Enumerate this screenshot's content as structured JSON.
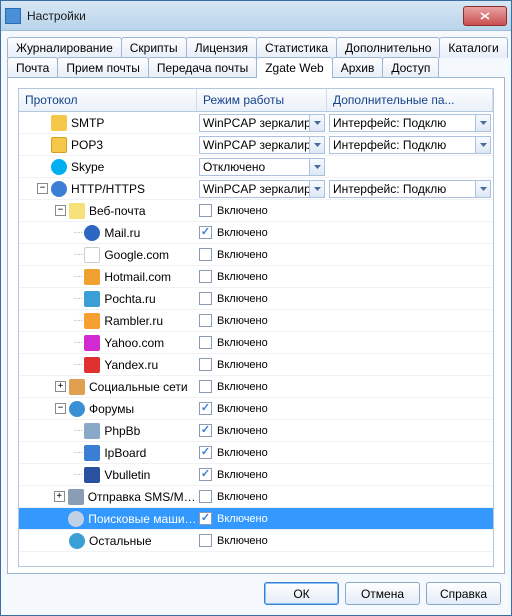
{
  "window": {
    "title": "Настройки"
  },
  "tabs_row1": [
    "Журналирование",
    "Скрипты",
    "Лицензия",
    "Статистика",
    "Дополнительно",
    "Каталоги"
  ],
  "tabs_row2": [
    "Почта",
    "Прием почты",
    "Передача почты",
    "Zgate Web",
    "Архив",
    "Доступ"
  ],
  "active_tab": "Zgate Web",
  "columns": {
    "proto": "Протокол",
    "mode": "Режим работы",
    "extra": "Дополнительные па..."
  },
  "checkbox_label": "Включено",
  "mode_off": "Отключено",
  "mode_pcap": "WinPCAP зеркалиров",
  "extra_iface": "Интерфейс: Подклю",
  "rows": [
    {
      "indent": 0,
      "expander": "none",
      "icon": "i-smtp",
      "name": "SMTP",
      "mode": "combo_pcap",
      "extra": "combo_iface"
    },
    {
      "indent": 0,
      "expander": "none",
      "icon": "i-pop3",
      "name": "POP3",
      "mode": "combo_pcap",
      "extra": "combo_iface"
    },
    {
      "indent": 0,
      "expander": "none",
      "icon": "i-skype",
      "name": "Skype",
      "mode": "combo_off",
      "extra": ""
    },
    {
      "indent": 0,
      "expander": "minus",
      "icon": "i-http",
      "name": "HTTP/HTTPS",
      "mode": "combo_pcap",
      "extra": "combo_iface"
    },
    {
      "indent": 1,
      "expander": "minus",
      "icon": "i-web",
      "name": "Веб-почта",
      "mode": "check_off",
      "extra": ""
    },
    {
      "indent": 2,
      "expander": "leaf",
      "icon": "i-mail",
      "name": "Mail.ru",
      "mode": "check_on",
      "extra": ""
    },
    {
      "indent": 2,
      "expander": "leaf",
      "icon": "i-google",
      "name": "Google.com",
      "mode": "check_off",
      "extra": ""
    },
    {
      "indent": 2,
      "expander": "leaf",
      "icon": "i-hotmail",
      "name": "Hotmail.com",
      "mode": "check_off",
      "extra": ""
    },
    {
      "indent": 2,
      "expander": "leaf",
      "icon": "i-pochta",
      "name": "Pochta.ru",
      "mode": "check_off",
      "extra": ""
    },
    {
      "indent": 2,
      "expander": "leaf",
      "icon": "i-rambler",
      "name": "Rambler.ru",
      "mode": "check_off",
      "extra": ""
    },
    {
      "indent": 2,
      "expander": "leaf",
      "icon": "i-yahoo",
      "name": "Yahoo.com",
      "mode": "check_off",
      "extra": ""
    },
    {
      "indent": 2,
      "expander": "leaf",
      "icon": "i-yandex",
      "name": "Yandex.ru",
      "mode": "check_off",
      "extra": ""
    },
    {
      "indent": 1,
      "expander": "plus",
      "icon": "i-social",
      "name": "Социальные сети",
      "mode": "check_off",
      "extra": ""
    },
    {
      "indent": 1,
      "expander": "minus",
      "icon": "i-forum",
      "name": "Форумы",
      "mode": "check_on",
      "extra": ""
    },
    {
      "indent": 2,
      "expander": "leaf",
      "icon": "i-phpbb",
      "name": "PhpBb",
      "mode": "check_on",
      "extra": ""
    },
    {
      "indent": 2,
      "expander": "leaf",
      "icon": "i-ipb",
      "name": "IpBoard",
      "mode": "check_on",
      "extra": ""
    },
    {
      "indent": 2,
      "expander": "leaf",
      "icon": "i-vb",
      "name": "Vbulletin",
      "mode": "check_on",
      "extra": ""
    },
    {
      "indent": 1,
      "expander": "plus",
      "icon": "i-sms",
      "name": "Отправка SMS/MMS",
      "mode": "check_off",
      "extra": ""
    },
    {
      "indent": 1,
      "expander": "none",
      "icon": "i-search",
      "name": "Поисковые машины",
      "mode": "check_on",
      "extra": "",
      "selected": true
    },
    {
      "indent": 1,
      "expander": "none",
      "icon": "i-other",
      "name": "Остальные",
      "mode": "check_off",
      "extra": ""
    }
  ],
  "buttons": {
    "ok": "ОК",
    "cancel": "Отмена",
    "help": "Справка"
  }
}
